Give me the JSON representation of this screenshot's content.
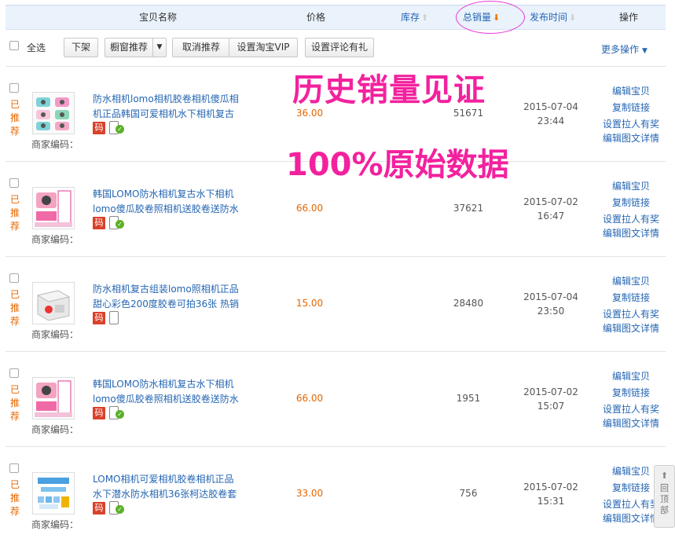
{
  "header": {
    "name": "宝贝名称",
    "price": "价格",
    "stock": "库存",
    "sales": "总销量",
    "date": "发布时间",
    "ops": "操作"
  },
  "toolbar": {
    "select_all": "全选",
    "delist": "下架",
    "window_recommend": "橱窗推荐",
    "cancel_recommend": "取消推荐",
    "set_vip": "设置淘宝VIP",
    "set_review_gift": "设置评论有礼",
    "more_ops": "更多操作"
  },
  "promo": {
    "line1": "历史销量见证",
    "line2": "100%原始数据"
  },
  "labels": {
    "recommended": [
      "已",
      "推",
      "荐"
    ],
    "merchant_code": "商家编码：",
    "code_badge": "码"
  },
  "ops_links": {
    "edit": "编辑宝贝",
    "copy": "复制链接",
    "invite": "设置拉人有奖",
    "edit_detail": "编辑图文详情"
  },
  "items": [
    {
      "title": "防水相机lomo相机胶卷相机傻瓜相机正品韩国可爱相机水下相机复古",
      "price": "36.00",
      "sales": "51671",
      "date": "2015-07-04",
      "time": "23:44"
    },
    {
      "title": "韩国LOMO防水相机复古水下相机lomo傻瓜胶卷照相机送胶卷送防水",
      "price": "66.00",
      "sales": "37621",
      "date": "2015-07-02",
      "time": "16:47"
    },
    {
      "title": "防水相机复古组装lomo照相机正品甜心彩色200度胶卷可拍36张 热销",
      "price": "15.00",
      "sales": "28480",
      "date": "2015-07-04",
      "time": "23:50"
    },
    {
      "title": "韩国LOMO防水相机复古水下相机lomo傻瓜胶卷照相机送胶卷送防水",
      "price": "66.00",
      "sales": "1951",
      "date": "2015-07-02",
      "time": "15:07"
    },
    {
      "title": "LOMO相机可爱相机胶卷相机正品水下潜水防水相机36张柯达胶卷套",
      "price": "33.00",
      "sales": "756",
      "date": "2015-07-02",
      "time": "15:31"
    }
  ],
  "back_to_top": [
    "回",
    "顶",
    "部"
  ]
}
